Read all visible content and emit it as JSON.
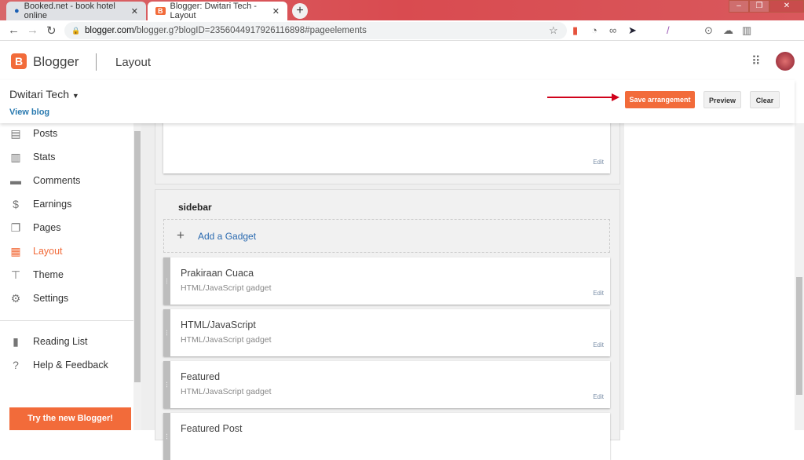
{
  "browser": {
    "tabs": [
      {
        "title": "Booked.net - book hotel online",
        "active": false
      },
      {
        "title": "Blogger: Dwitari Tech - Layout",
        "active": true
      }
    ],
    "url_domain": "blogger.com",
    "url_rest": "/blogger.g?blogID=2356044917926116898#pageelements",
    "ext_badge": "redir"
  },
  "header": {
    "app": "Blogger",
    "section": "Layout"
  },
  "blog": {
    "name": "Dwitari Tech",
    "view_blog": "View blog"
  },
  "toolbar": {
    "save": "Save arrangement",
    "preview": "Preview",
    "clear": "Clear"
  },
  "sidebar": {
    "items": [
      {
        "label": "Posts",
        "icon": "posts-icon"
      },
      {
        "label": "Stats",
        "icon": "stats-icon"
      },
      {
        "label": "Comments",
        "icon": "comments-icon"
      },
      {
        "label": "Earnings",
        "icon": "dollar-icon"
      },
      {
        "label": "Pages",
        "icon": "pages-icon"
      },
      {
        "label": "Layout",
        "icon": "layout-icon"
      },
      {
        "label": "Theme",
        "icon": "paint-roller-icon"
      },
      {
        "label": "Settings",
        "icon": "gear-icon"
      }
    ],
    "secondary": [
      {
        "label": "Reading List"
      },
      {
        "label": "Help & Feedback"
      }
    ],
    "try_new": "Try the new Blogger!"
  },
  "layout": {
    "top_edit": "Edit",
    "section_title": "sidebar",
    "add_gadget": "Add a Gadget",
    "gadgets": [
      {
        "title": "Prakiraan Cuaca",
        "type": "HTML/JavaScript gadget",
        "edit": "Edit"
      },
      {
        "title": "HTML/JavaScript",
        "type": "HTML/JavaScript gadget",
        "edit": "Edit"
      },
      {
        "title": "Featured",
        "type": "HTML/JavaScript gadget",
        "edit": "Edit"
      },
      {
        "title": "Featured Post"
      }
    ]
  },
  "colors": {
    "accent": "#f26b3a",
    "arrow": "#d0021b"
  }
}
